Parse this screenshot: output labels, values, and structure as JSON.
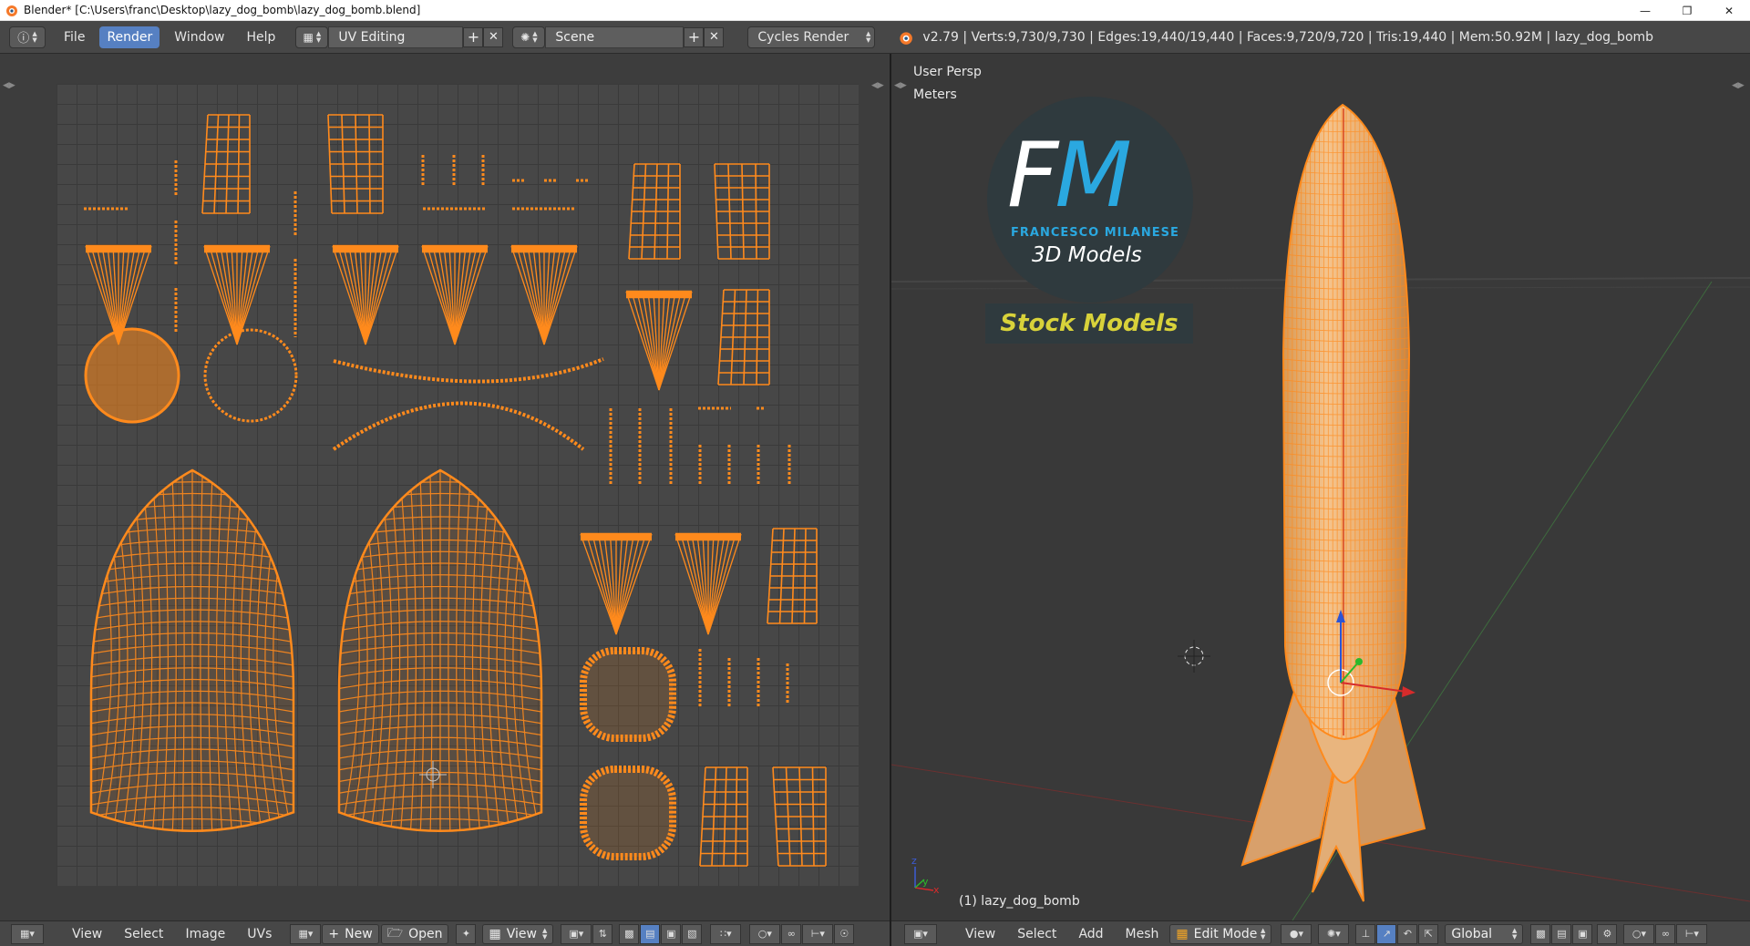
{
  "window": {
    "title": "Blender* [C:\\Users\\franc\\Desktop\\lazy_dog_bomb\\lazy_dog_bomb.blend]",
    "controls": [
      "minimize-icon",
      "restore-icon",
      "close-icon"
    ]
  },
  "info_header": {
    "menus": [
      "File",
      "Render",
      "Window",
      "Help"
    ],
    "active_menu": "Render",
    "screen_layout": "UV Editing",
    "scene": "Scene",
    "render_engine": "Cycles Render",
    "stats": "v2.79 | Verts:9,730/9,730 | Edges:19,440/19,440 | Faces:9,720/9,720 | Tris:19,440 | Mem:50.92M | lazy_dog_bomb"
  },
  "viewport": {
    "view_name": "User Persp",
    "units": "Meters",
    "object_label": "(1) lazy_dog_bomb",
    "watermark": {
      "logo_letters": "FM",
      "name": "FRANCESCO MILANESE",
      "subtitle": "3D Models",
      "badge": "Stock Models"
    }
  },
  "uv_bottom": {
    "menus": [
      "View",
      "Select",
      "Image",
      "UVs"
    ],
    "new_label": "New",
    "open_label": "Open",
    "view_label": "View"
  },
  "vp_bottom": {
    "menus": [
      "View",
      "Select",
      "Add",
      "Mesh"
    ],
    "mode": "Edit Mode",
    "orientation": "Global"
  },
  "colors": {
    "uv_orange": "#ff8a1c",
    "blender_bg": "#3d3d3d",
    "header_bg": "#474747",
    "active_blue": "#5680c2",
    "logo_blue": "#2aa8e0",
    "stock_yellow": "#d8d23a"
  }
}
